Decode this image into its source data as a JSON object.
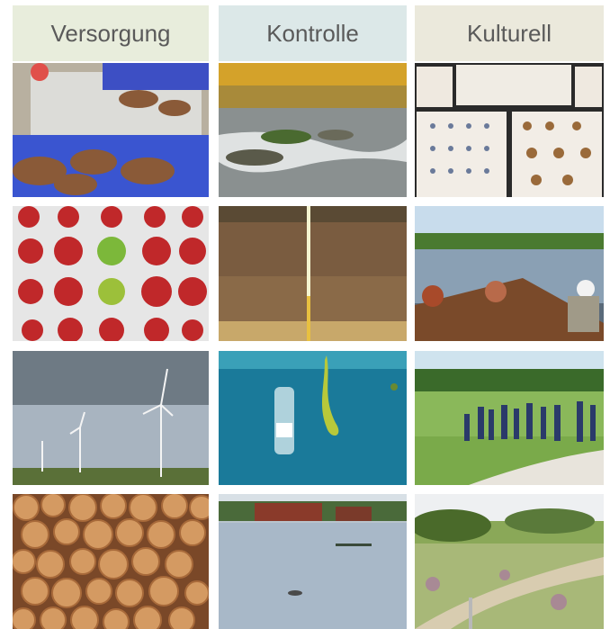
{
  "columns": [
    {
      "header": "Versorgung",
      "color": "#e8eddc"
    },
    {
      "header": "Kontrolle",
      "color": "#dce8e8"
    },
    {
      "header": "Kulturell",
      "color": "#ebe9dc"
    }
  ],
  "images": [
    [
      "crabs-crates",
      "forest-stream",
      "butterfly-collection",
      "log-pile"
    ],
    [
      "apple-varieties",
      "soil-profile",
      "boat-tour",
      "flooded-meadow"
    ],
    [
      "wind-turbines",
      "underwater-plastic-bottle",
      "hiking-group-dunes",
      "heathland-landscape"
    ]
  ]
}
